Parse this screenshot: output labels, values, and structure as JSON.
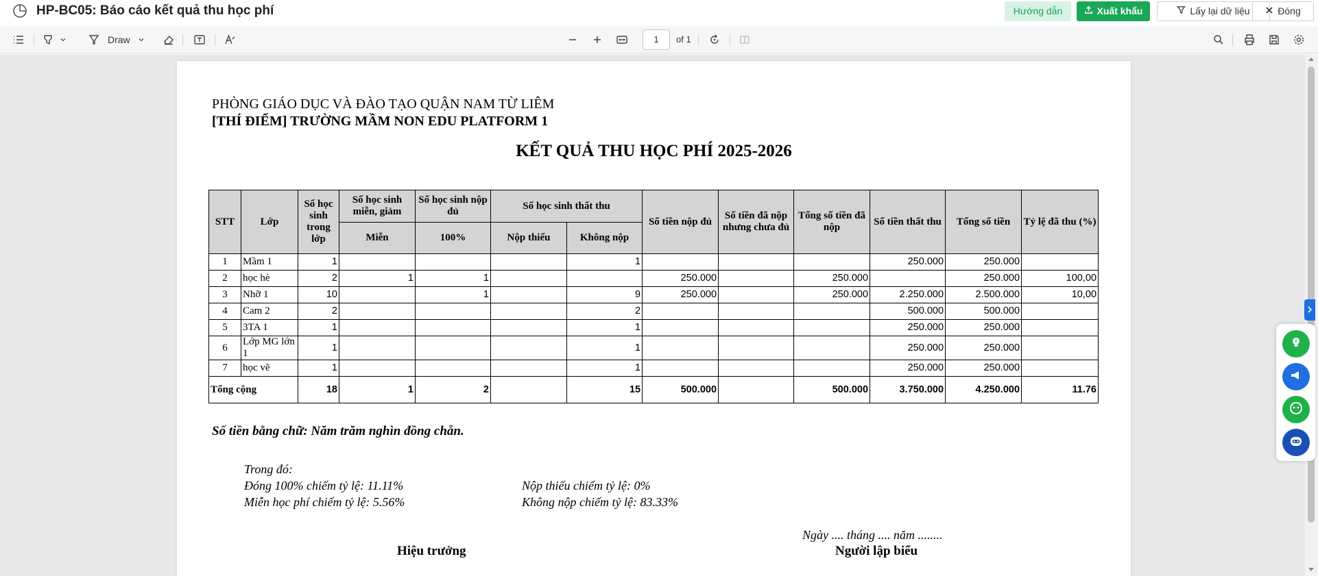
{
  "window": {
    "title": "HP-BC05: Báo cáo kết quả thu học phí",
    "guide_label": "Hướng dẫn",
    "export_label": "Xuất khẩu",
    "reload_label": "Lấy lại dữ liệu",
    "close_label": "Đóng"
  },
  "toolbar": {
    "draw_label": "Draw",
    "page_number": "1",
    "page_of": "of 1"
  },
  "colors": {
    "accent_green": "#19a857",
    "guide_bg": "#d9f2e5",
    "header_gray": "#d4d4d4",
    "side_blue": "#1f6fe0"
  },
  "report": {
    "org_line1": "PHÒNG GIÁO DỤC VÀ ĐÀO TẠO QUẬN NAM TỪ LIÊM",
    "org_line2": "[THÍ ĐIỂM] TRƯỜNG MẦM NON EDU PLATFORM 1",
    "title": "KẾT QUẢ THU HỌC PHÍ 2025-2026",
    "headers": {
      "stt": "STT",
      "lop": "Lớp",
      "so_hs": "Số học sinh trong lớp",
      "mien_giam": "Số học sinh miễn, giảm",
      "mien": "Miễn",
      "nop_du": "Số học sinh nộp đủ",
      "pct100": "100%",
      "that_thu": "Số học sinh thất thu",
      "nop_thieu": "Nộp thiếu",
      "khong_nop": "Không nộp",
      "tien_nop_du": "Số tiền nộp đủ",
      "tien_chua_du": "Số tiền đã nộp nhưng chưa đủ",
      "tong_da_nop": "Tổng số tiền đã nộp",
      "tien_that_thu": "Số tiền thất thu",
      "tong_tien": "Tổng số tiền",
      "ty_le": "Tỷ lệ đã thu (%)"
    },
    "rows": [
      [
        "1",
        "Mầm 1",
        "1",
        "",
        "",
        "",
        "1",
        "",
        "",
        "",
        "250.000",
        "250.000",
        ""
      ],
      [
        "2",
        "học hè",
        "2",
        "1",
        "1",
        "",
        "",
        "250.000",
        "",
        "250.000",
        "",
        "250.000",
        "100,00"
      ],
      [
        "3",
        "Nhỡ 1",
        "10",
        "",
        "1",
        "",
        "9",
        "250.000",
        "",
        "250.000",
        "2.250.000",
        "2.500.000",
        "10,00"
      ],
      [
        "4",
        "Cam 2",
        "2",
        "",
        "",
        "",
        "2",
        "",
        "",
        "",
        "500.000",
        "500.000",
        ""
      ],
      [
        "5",
        "3TA 1",
        "1",
        "",
        "",
        "",
        "1",
        "",
        "",
        "",
        "250.000",
        "250.000",
        ""
      ],
      [
        "6",
        "Lớp MG lớn  1",
        "1",
        "",
        "",
        "",
        "1",
        "",
        "",
        "",
        "250.000",
        "250.000",
        ""
      ],
      [
        "7",
        "học vẽ",
        "1",
        "",
        "",
        "",
        "1",
        "",
        "",
        "",
        "250.000",
        "250.000",
        ""
      ]
    ],
    "total": {
      "label": "Tổng cộng",
      "values": [
        "18",
        "1",
        "2",
        "",
        "15",
        "500.000",
        "",
        "500.000",
        "3.750.000",
        "4.250.000",
        "11.76"
      ]
    },
    "amount_words": "Số tiền bằng chữ: Năm trăm nghìn đồng chẵn.",
    "breakdown_title": "Trong đó:",
    "rate_full": "Đóng 100% chiếm tỷ lệ: 11.11%",
    "rate_partial": "Nộp thiếu chiếm tỷ lệ: 0%",
    "rate_exempt": "Miễn học phí chiếm tỷ lệ: 5.56%",
    "rate_unpaid": "Không nộp chiếm tỷ lệ: 83.33%",
    "date_line": "Ngày .... tháng .... năm ........",
    "signer_left": "Hiệu trưởng",
    "signer_right": "Người lập biểu"
  }
}
